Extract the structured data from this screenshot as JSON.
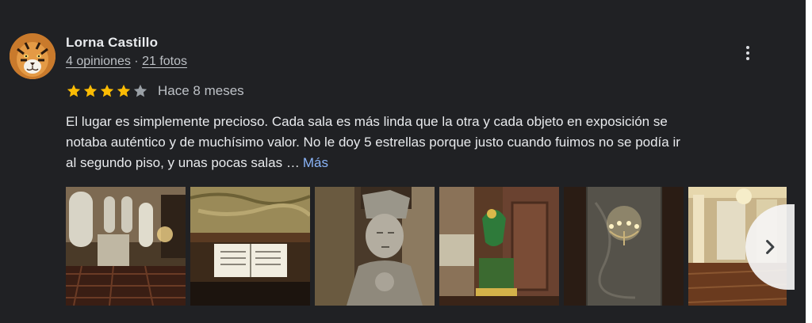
{
  "review": {
    "author": "Lorna Castillo",
    "reviews_count": "4 opiniones",
    "separator": "·",
    "photos_count": "21 fotos",
    "rating": 4,
    "max_rating": 5,
    "time_ago": "Hace 8 meses",
    "text_lines": [
      "El lugar es simplemente precioso. Cada sala es más linda que la otra y cada objeto en exposición se",
      "notaba auténtico y de muchísimo valor. No le doy 5 estrellas porque justo cuando fuimos no se podía ir",
      "al segundo piso, y unas pocas salas …"
    ],
    "more_label": "Más"
  },
  "colors": {
    "background": "#202124",
    "star_filled": "#fbbc04",
    "star_empty": "#9aa0a6",
    "link": "#8ab4f8"
  },
  "icons": {
    "more": "more-vert-icon",
    "next": "chevron-right-icon"
  }
}
